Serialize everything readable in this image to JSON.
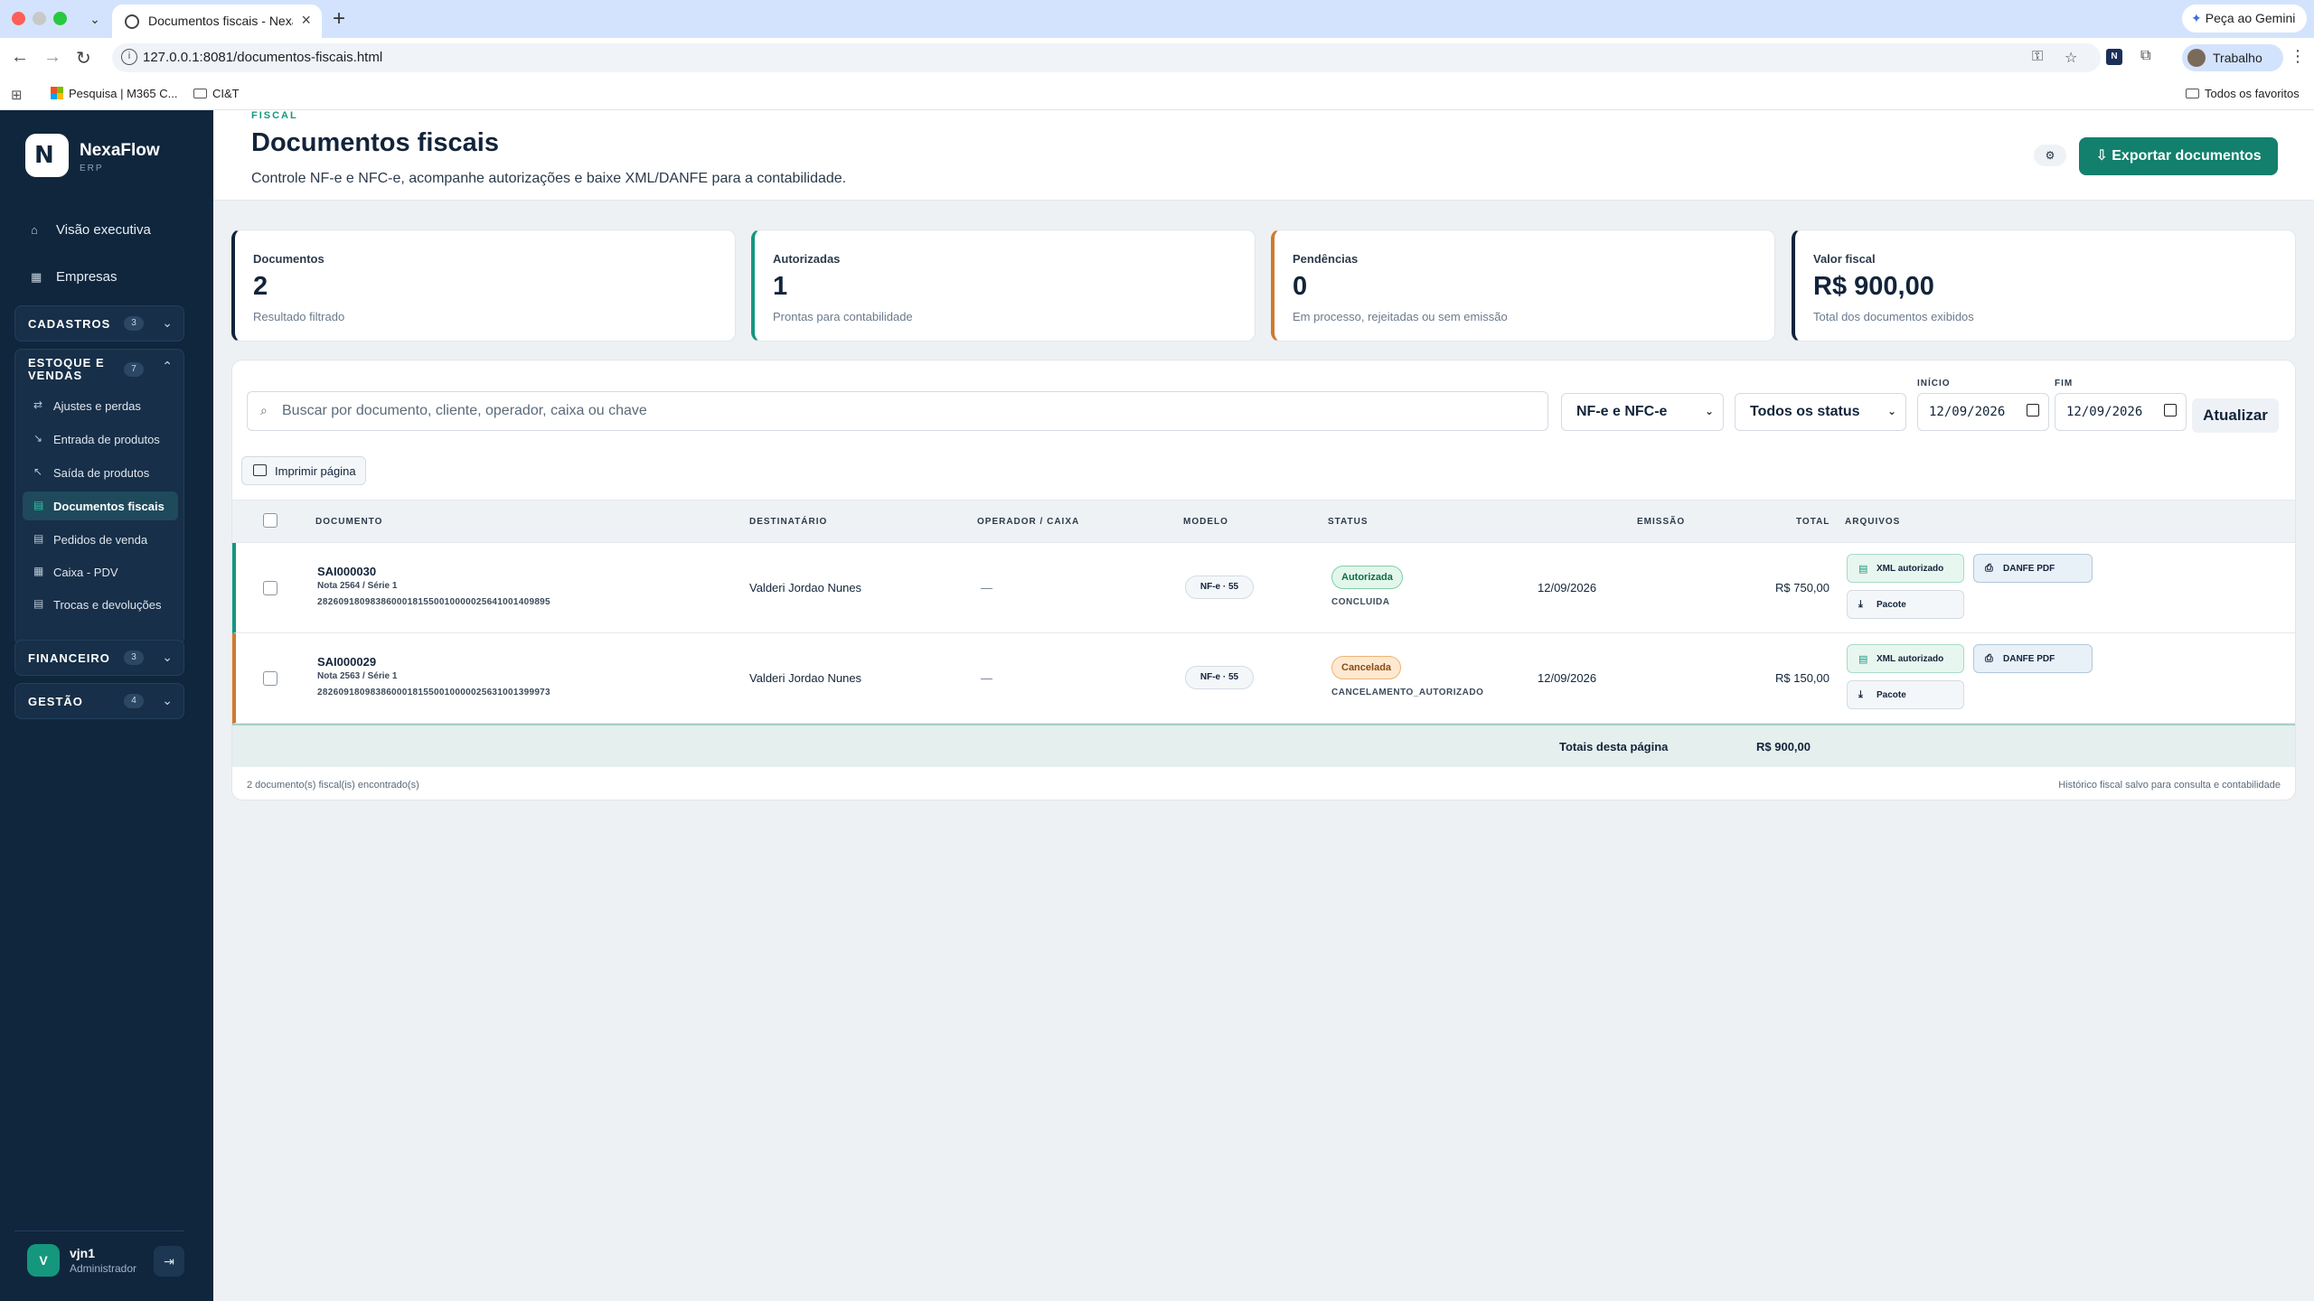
{
  "browser": {
    "tab_title": "Documentos fiscais - NexaFlow",
    "url": "127.0.0.1:8081/documentos-fiscais.html",
    "gemini_label": "Peça ao Gemini",
    "profile_label": "Trabalho",
    "bookmarks": [
      "Pesquisa | M365 C...",
      "CI&T"
    ],
    "all_bookmarks": "Todos os favoritos"
  },
  "sidebar": {
    "brand": "NexaFlow",
    "brand_sub": "ERP",
    "top_items": [
      {
        "label": "Visão executiva",
        "icon": "home-icon"
      },
      {
        "label": "Empresas",
        "icon": "building-icon"
      }
    ],
    "groups": {
      "cadastros": {
        "label": "CADASTROS",
        "count": "3"
      },
      "estoque": {
        "label": "ESTOQUE E VENDAS",
        "count": "7",
        "items": [
          {
            "label": "Ajustes e perdas",
            "icon": "swap-icon"
          },
          {
            "label": "Entrada de produtos",
            "icon": "arrow-in-icon"
          },
          {
            "label": "Saída de produtos",
            "icon": "arrow-out-icon"
          },
          {
            "label": "Documentos fiscais",
            "icon": "document-icon",
            "active": true
          },
          {
            "label": "Pedidos de venda",
            "icon": "cart-icon"
          },
          {
            "label": "Caixa - PDV",
            "icon": "register-icon"
          },
          {
            "label": "Trocas e devoluções",
            "icon": "return-icon"
          }
        ]
      },
      "financeiro": {
        "label": "FINANCEIRO",
        "count": "3"
      },
      "gestao": {
        "label": "GESTÃO",
        "count": "4"
      }
    },
    "user": {
      "initial": "V",
      "name": "vjn1",
      "role": "Administrador"
    }
  },
  "header": {
    "eyebrow": "FISCAL",
    "title": "Documentos fiscais",
    "description": "Controle NF-e e NFC-e, acompanhe autorizações e baixe XML/DANFE para a contabilidade.",
    "export_label": "Exportar documentos"
  },
  "stats": [
    {
      "label": "Documentos",
      "value": "2",
      "sub": "Resultado filtrado",
      "accent": "#12243a"
    },
    {
      "label": "Autorizadas",
      "value": "1",
      "sub": "Prontas para contabilidade",
      "accent": "#15977e"
    },
    {
      "label": "Pendências",
      "value": "0",
      "sub": "Em processo, rejeitadas ou sem emissão",
      "accent": "#d07a2d"
    },
    {
      "label": "Valor fiscal",
      "value": "R$ 900,00",
      "sub": "Total dos documentos exibidos",
      "accent": "#12243a"
    }
  ],
  "filters": {
    "search_placeholder": "Buscar por documento, cliente, operador, caixa ou chave",
    "model_value": "NF-e e NFC-e",
    "status_value": "Todos os status",
    "start_label": "INÍCIO",
    "start_value": "12/09/2026",
    "end_label": "FIM",
    "end_value": "12/09/2026",
    "refresh_label": "Atualizar",
    "print_label": "Imprimir página"
  },
  "table": {
    "headers": [
      "DOCUMENTO",
      "DESTINATÁRIO",
      "OPERADOR / CAIXA",
      "MODELO",
      "STATUS",
      "EMISSÃO",
      "TOTAL",
      "ARQUIVOS"
    ],
    "rows": [
      {
        "code": "SAI000030",
        "nota": "Nota 2564 / Série 1",
        "key": "28260918098386000181550010000025641001409895",
        "recipient": "Valderi Jordao Nunes",
        "operator": "—",
        "model": "NF-e · 55",
        "status": "Autorizada",
        "status_detail": "CONCLUIDA",
        "date": "12/09/2026",
        "total": "R$ 750,00"
      },
      {
        "code": "SAI000029",
        "nota": "Nota 2563 / Série 1",
        "key": "28260918098386000181550010000025631001399973",
        "recipient": "Valderi Jordao Nunes",
        "operator": "—",
        "model": "NF-e · 55",
        "status": "Cancelada",
        "status_detail": "CANCELAMENTO_AUTORIZADO",
        "date": "12/09/2026",
        "total": "R$ 150,00"
      }
    ],
    "file_buttons": {
      "xml": "XML autorizado",
      "danfe": "DANFE PDF",
      "pacote": "Pacote"
    },
    "footer_label": "Totais desta página",
    "footer_total": "R$ 900,00"
  },
  "panel_footer": {
    "left": "2 documento(s) fiscal(is) encontrado(s)",
    "right": "Histórico fiscal salvo para consulta e contabilidade"
  }
}
